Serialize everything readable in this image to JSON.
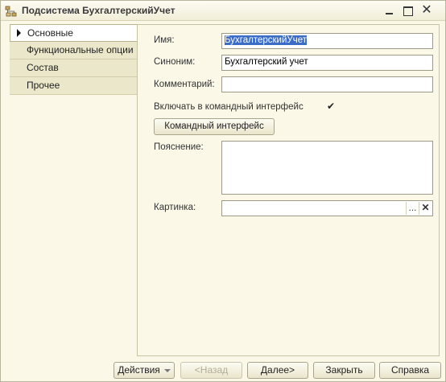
{
  "window": {
    "title": "Подсистема БухгалтерскийУчет",
    "close_glyph": "✕"
  },
  "nav": {
    "items": [
      {
        "label": "Основные",
        "active": true
      },
      {
        "label": "Функциональные опции"
      },
      {
        "label": "Состав"
      },
      {
        "label": "Прочее"
      }
    ]
  },
  "form": {
    "name_label": "Имя:",
    "name_value": "БухгалтерскийУчет",
    "synonym_label": "Синоним:",
    "synonym_value": "Бухгалтерский учет",
    "comment_label": "Комментарий:",
    "comment_value": "",
    "include_label": "Включать в командный интерфейс",
    "include_checked": true,
    "command_interface_button": "Командный интерфейс",
    "explanation_label": "Пояснение:",
    "explanation_value": "",
    "picture_label": "Картинка:",
    "picture_value": "",
    "picture_select_glyph": "...",
    "picture_clear_glyph": "✕",
    "checkbox_glyph": "✔"
  },
  "footer": {
    "actions": "Действия",
    "back": "<Назад",
    "next": "Далее>",
    "close": "Закрыть",
    "help": "Справка"
  },
  "colors": {
    "background": "#fbf8e8",
    "selection": "#3b6dc7"
  }
}
